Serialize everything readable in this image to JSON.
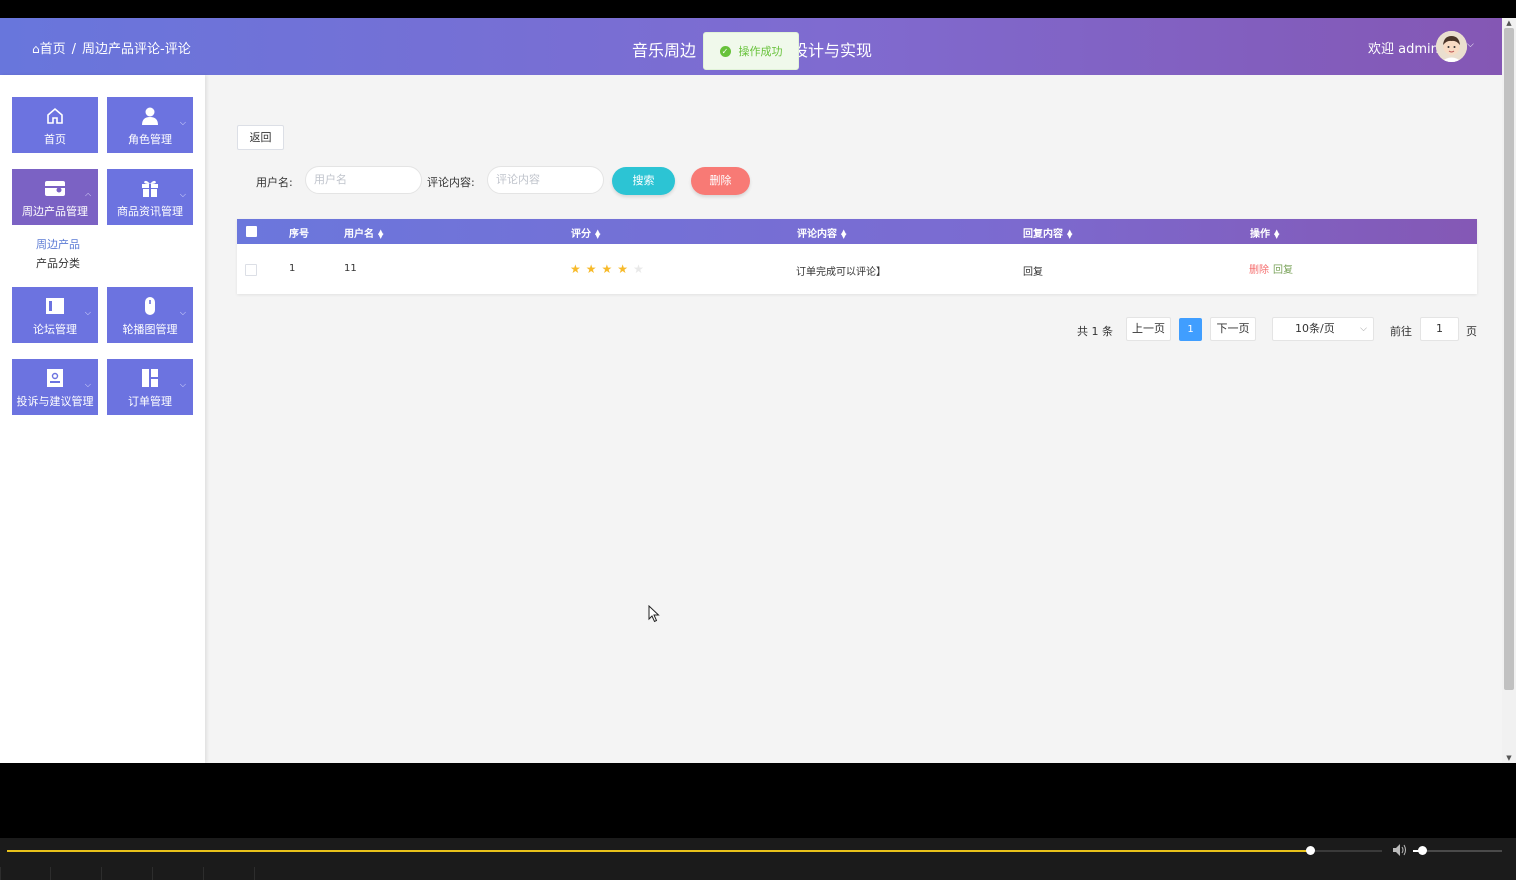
{
  "header": {
    "breadcrumb_home": "首页",
    "breadcrumb_separator": "/",
    "breadcrumb_current": "周边产品评论-评论",
    "site_title_left": "音乐周边",
    "site_title_right": "设计与实现",
    "welcome": "欢迎 admin",
    "toast": "操作成功"
  },
  "sidebar": {
    "tiles": [
      {
        "label": "首页",
        "icon": "home-icon"
      },
      {
        "label": "角色管理",
        "icon": "user-icon"
      },
      {
        "label": "周边产品管理",
        "icon": "wallet-icon"
      },
      {
        "label": "商品资讯管理",
        "icon": "gift-icon"
      },
      {
        "label": "论坛管理",
        "icon": "panel-icon"
      },
      {
        "label": "轮播图管理",
        "icon": "mouse-icon"
      },
      {
        "label": "投诉与建议管理",
        "icon": "id-card-icon"
      },
      {
        "label": "订单管理",
        "icon": "dashboard-icon"
      }
    ],
    "submenu": [
      "周边产品",
      "产品分类"
    ]
  },
  "toolbar": {
    "back": "返回",
    "username_label": "用户名:",
    "username_placeholder": "用户名",
    "comment_label": "评论内容:",
    "comment_placeholder": "评论内容",
    "search": "搜索",
    "delete": "删除"
  },
  "table": {
    "columns": [
      "序号",
      "用户名",
      "评分",
      "评论内容",
      "回复内容",
      "操作"
    ],
    "rows": [
      {
        "index": "1",
        "username": "11",
        "rating": 4,
        "rating_max": 5,
        "comment": "订单完成可以评论】",
        "reply": "回复",
        "op_delete": "删除",
        "op_reply": "回复"
      }
    ]
  },
  "pagination": {
    "total": "共 1 条",
    "prev": "上一页",
    "current": "1",
    "next": "下一页",
    "page_size": "10条/页",
    "goto_label": "前往",
    "goto_value": "1",
    "page_suffix": "页"
  },
  "colors": {
    "header_start": "#6876dc",
    "header_end": "#8457b4",
    "tile": "#6c73e0",
    "search": "#2cc4d4",
    "delete": "#f87a75",
    "page_active": "#409eff",
    "star": "#f7ba2a"
  },
  "media_player": {
    "progress": 0.948,
    "volume": 0.11
  }
}
